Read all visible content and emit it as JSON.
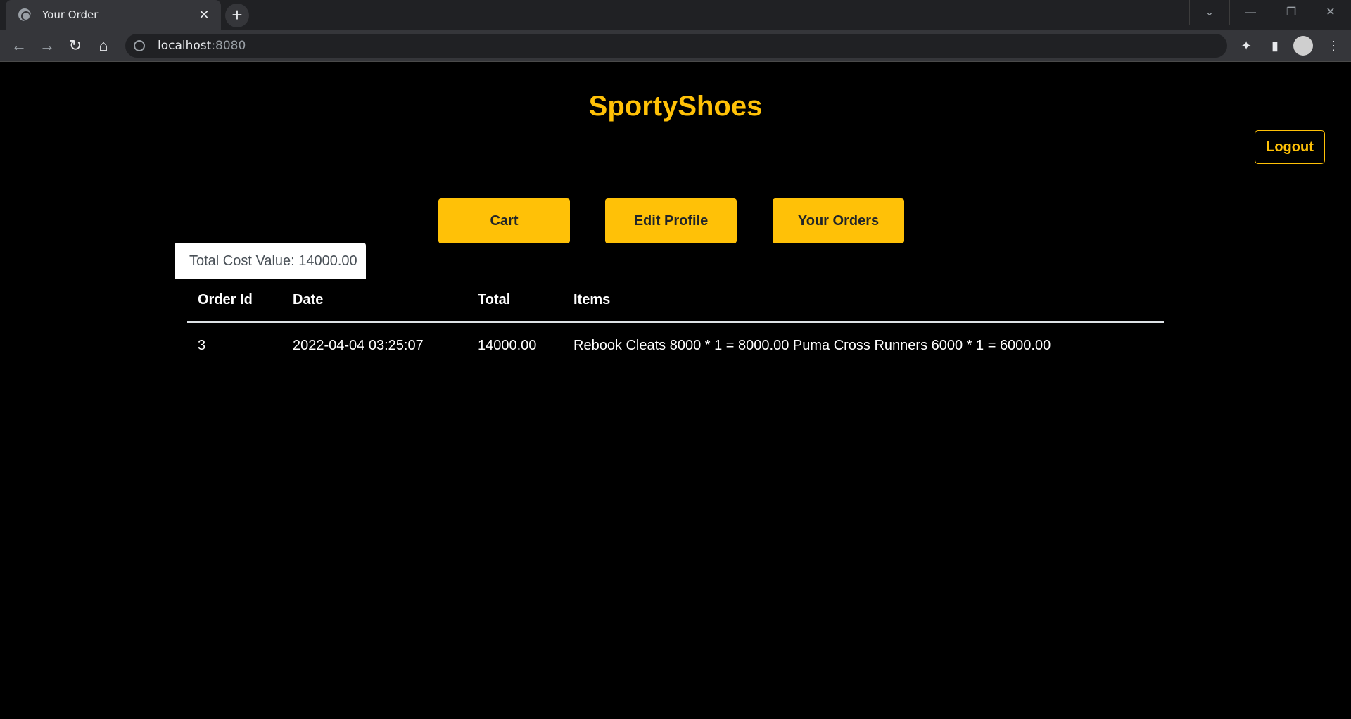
{
  "browser": {
    "tab_title": "Your Order",
    "url_host": "localhost",
    "url_port": ":8080"
  },
  "header": {
    "brand": "SportyShoes",
    "logout_label": "Logout"
  },
  "nav": {
    "cart_label": "Cart",
    "edit_profile_label": "Edit Profile",
    "your_orders_label": "Your Orders"
  },
  "summary": {
    "total_cost": "Total Cost Value: 14000.00"
  },
  "orders_table": {
    "headers": [
      "Order Id",
      "Date",
      "Total",
      "Items"
    ],
    "rows": [
      [
        "3",
        "2022-04-04 03:25:07",
        "14000.00",
        "Rebook Cleats 8000 * 1 = 8000.00 Puma Cross Runners 6000 * 1 = 6000.00"
      ]
    ]
  },
  "colors": {
    "accent": "#ffc107",
    "background": "#000000"
  }
}
